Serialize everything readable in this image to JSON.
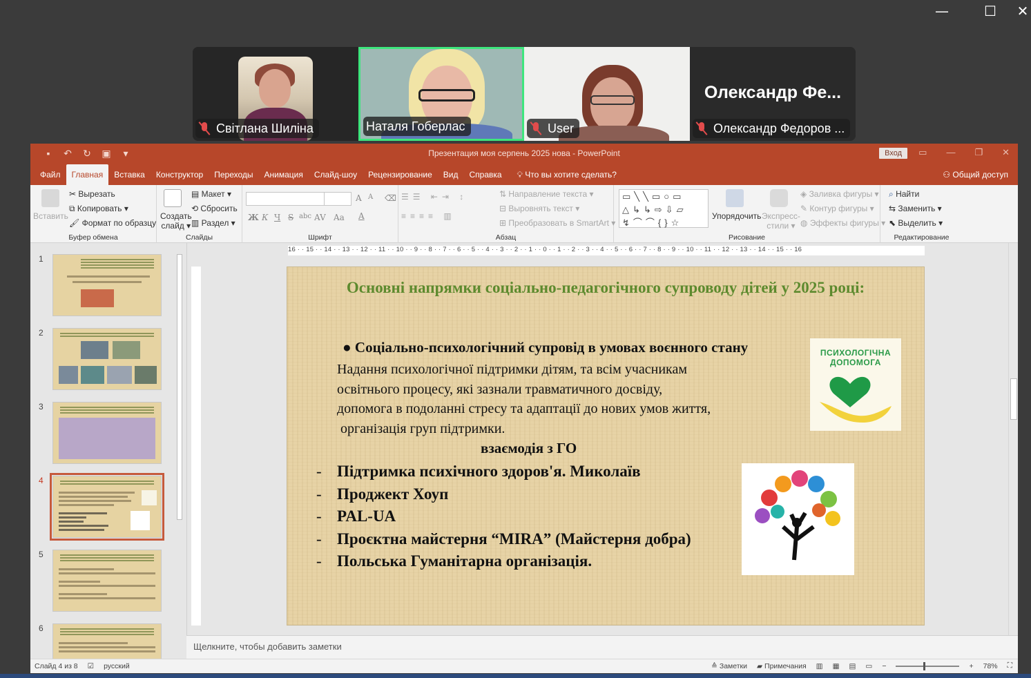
{
  "window_controls": {
    "minimize": "—",
    "maximize": "☐",
    "close": "✕"
  },
  "participants": [
    {
      "name": "Світлана Шиліна",
      "muted": true,
      "video": true
    },
    {
      "name": "Наталя Гоберлас",
      "muted": false,
      "video": true,
      "active_speaker": true
    },
    {
      "name": "User",
      "muted": true,
      "video": true
    },
    {
      "name": "Олександр Федоров ...",
      "display_text": "Олександр  Фе...",
      "muted": true,
      "video": false
    }
  ],
  "ppt": {
    "title": "Презентация  моя серпень 2025 нова  -  PowerPoint",
    "sign_in": "Вход",
    "share": "Общий доступ",
    "menu": [
      "Файл",
      "Главная",
      "Вставка",
      "Конструктор",
      "Переходы",
      "Анимация",
      "Слайд-шоу",
      "Рецензирование",
      "Вид",
      "Справка"
    ],
    "active_menu": "Главная",
    "tell_me": "Что вы хотите сделать?",
    "ribbon": {
      "clipboard": {
        "paste": "Вставить",
        "cut": "Вырезать",
        "copy": "Копировать",
        "format_painter": "Формат по образцу",
        "group": "Буфер обмена"
      },
      "slides": {
        "new_slide_1": "Создать",
        "new_slide_2": "слайд",
        "layout": "Макет",
        "reset": "Сбросить",
        "section": "Раздел",
        "group": "Слайды"
      },
      "font": {
        "bold": "Ж",
        "italic": "К",
        "underline": "Ч",
        "strike": "S",
        "shadow": "abc",
        "spacing": "AV",
        "case": "Aa",
        "color": "A",
        "grow": "A",
        "shrink": "A",
        "group": "Шрифт"
      },
      "paragraph": {
        "text_dir": "Направление текста",
        "align_text": "Выровнять текст",
        "smartart": "Преобразовать в SmartArt",
        "group": "Абзац"
      },
      "drawing": {
        "arrange": "Упорядочить",
        "quick_styles_1": "Экспресс-",
        "quick_styles_2": "стили",
        "fill": "Заливка фигуры",
        "outline": "Контур фигуры",
        "effects": "Эффекты фигуры",
        "group": "Рисование",
        "shapes_row1": "▭╲╲▭○▭",
        "shapes_row2": "△↳↳⇨⇩▱",
        "shapes_row3": "↯⌒⌒{}☆"
      },
      "editing": {
        "find": "Найти",
        "replace": "Заменить",
        "select": "Выделить",
        "group": "Редактирование"
      }
    },
    "ruler": "16 · · 15 · · 14 · · 13 · · 12 · · 11 · · 10 · · 9 · · 8 · · 7 · · 6 · · 5 · · 4 · · 3 · · 2 · · 1 · · 0 · · 1 · · 2 · · 3 · · 4 · · 5 · · 6 · · 7 · · 8 · · 9 · · 10 · · 11 · · 12 · · 13 · · 14 · · 15 · · 16",
    "thumbnails": [
      {
        "num": "1"
      },
      {
        "num": "2"
      },
      {
        "num": "3"
      },
      {
        "num": "4",
        "selected": true
      },
      {
        "num": "5"
      },
      {
        "num": "6"
      }
    ],
    "slide": {
      "title": "Основні напрямки соціально-педагогічного супроводу дітей у 2025 році:",
      "bullet": "●  Соціально-психологічний супровід в умовах воєнного стану",
      "para_lines": [
        "Надання психологічної підтримки дітям, та всім учасникам",
        "освітнього процесу, які зазнали травматичного досвіду,",
        "допомога в подоланні стресу та адаптації до нових умов життя,",
        " організація груп підтримки."
      ],
      "ngo_heading": "взаємодія з ГО",
      "list": [
        "Підтримка психічного здоров'я. Миколаїв",
        "Проджект Хоуп",
        "PAL-UA",
        "Проєктна майстерня “MIRA” (Майстерня добра)",
        "Польська Гуманітарна організація."
      ],
      "list_marker": "-",
      "image1_text": "ПСИХОЛОГІЧНА ДОПОМОГА",
      "accent_title_color": "#5d8a2e"
    },
    "notes_placeholder": "Щелкните, чтобы добавить заметки",
    "status": {
      "slide_info": "Слайд 4 из 8",
      "language": "русский",
      "notes": "Заметки",
      "comments": "Примечания",
      "zoom": "78%"
    }
  }
}
